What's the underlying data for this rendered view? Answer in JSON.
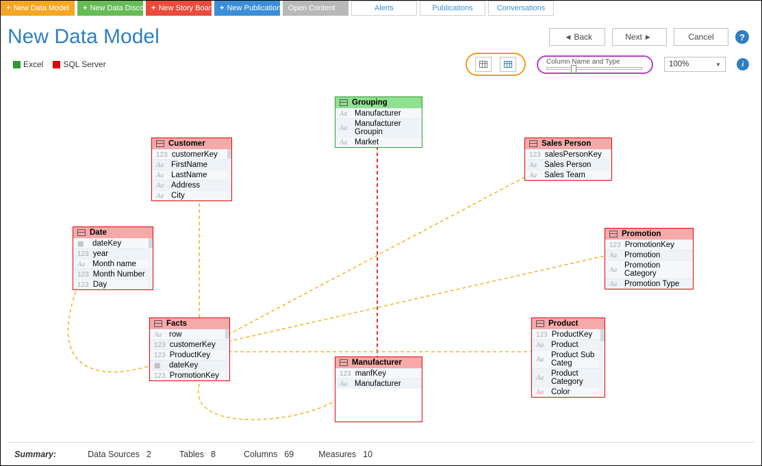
{
  "tabs": {
    "new_data_model": "New Data Model",
    "new_data_discovery": "New Data Discovery",
    "new_story_board": "New Story Board",
    "new_publication": "New Publication",
    "open_content": "Open Content",
    "alerts": "Alerts",
    "publications": "Publications",
    "conversations": "Conversations"
  },
  "header": {
    "title": "New Data Model",
    "back_label": "Back",
    "next_label": "Next",
    "cancel_label": "Cancel"
  },
  "legend": {
    "excel": "Excel",
    "sqlserver": "SQL Server"
  },
  "toolbar": {
    "slider_label": "Column Name and Type",
    "zoom_value": "100%"
  },
  "tables": {
    "grouping": {
      "title": "Grouping",
      "cols": [
        {
          "t": "Aa",
          "n": "Manufacturer"
        },
        {
          "t": "Aa",
          "n": "Manufacturer Groupin"
        },
        {
          "t": "Aa",
          "n": "Market"
        }
      ]
    },
    "customer": {
      "title": "Customer",
      "cols": [
        {
          "t": "123",
          "n": "customerKey"
        },
        {
          "t": "Aa",
          "n": "FirstName"
        },
        {
          "t": "Aa",
          "n": "LastName"
        },
        {
          "t": "Aa",
          "n": "Address"
        },
        {
          "t": "Aa",
          "n": "City"
        }
      ]
    },
    "salesperson": {
      "title": "Sales Person",
      "cols": [
        {
          "t": "123",
          "n": "salesPersonKey"
        },
        {
          "t": "Aa",
          "n": "Sales Person"
        },
        {
          "t": "Aa",
          "n": "Sales Team"
        }
      ]
    },
    "date": {
      "title": "Date",
      "cols": [
        {
          "t": "📅",
          "n": "dateKey"
        },
        {
          "t": "123",
          "n": "year"
        },
        {
          "t": "Aa",
          "n": "Month name"
        },
        {
          "t": "123",
          "n": "Month Number"
        },
        {
          "t": "123",
          "n": "Day"
        }
      ]
    },
    "promotion": {
      "title": "Promotion",
      "cols": [
        {
          "t": "123",
          "n": "PromotionKey"
        },
        {
          "t": "Aa",
          "n": "Promotion"
        },
        {
          "t": "Aa",
          "n": "Promotion Category"
        },
        {
          "t": "Aa",
          "n": "Promotion Type"
        }
      ]
    },
    "facts": {
      "title": "Facts",
      "cols": [
        {
          "t": "Aa",
          "n": "row"
        },
        {
          "t": "123",
          "n": "customerKey"
        },
        {
          "t": "123",
          "n": "ProductKey"
        },
        {
          "t": "📅",
          "n": "dateKey"
        },
        {
          "t": "123",
          "n": "PromotionKey"
        }
      ]
    },
    "manufacturer": {
      "title": "Manufacturer",
      "cols": [
        {
          "t": "123",
          "n": "manfKey"
        },
        {
          "t": "Aa",
          "n": "Manufacturer"
        }
      ]
    },
    "product": {
      "title": "Product",
      "cols": [
        {
          "t": "123",
          "n": "ProductKey"
        },
        {
          "t": "Aa",
          "n": "Product"
        },
        {
          "t": "Aa",
          "n": "Product Sub Categ"
        },
        {
          "t": "Aa",
          "n": "Product Category"
        },
        {
          "t": "Aa",
          "n": "Color"
        }
      ]
    }
  },
  "summary": {
    "label": "Summary:",
    "data_sources_label": "Data Sources",
    "data_sources_value": "2",
    "tables_label": "Tables",
    "tables_value": "8",
    "columns_label": "Columns",
    "columns_value": "69",
    "measures_label": "Measures",
    "measures_value": "10"
  }
}
